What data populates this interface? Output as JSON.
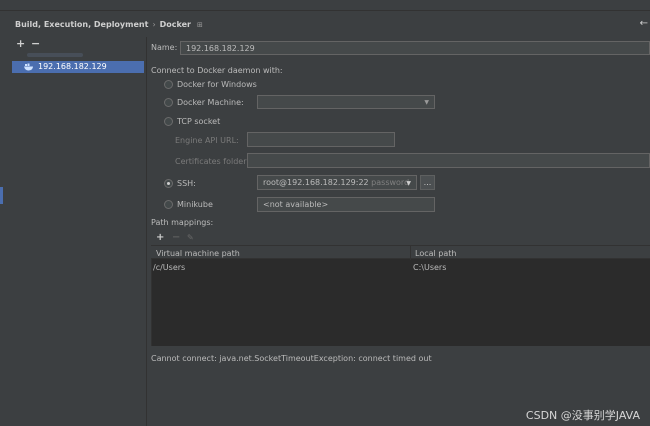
{
  "header": {
    "crumb_parent": "Build, Execution, Deployment",
    "crumb_sep": "›",
    "crumb_current": "Docker",
    "pin_icon": "⊞",
    "back_icon": "←"
  },
  "left": {
    "add_label": "+",
    "remove_label": "−",
    "selected_item": "192.168.182.129"
  },
  "form": {
    "name_label": "Name:",
    "name_value": "192.168.182.129",
    "connect_label": "Connect to Docker daemon with:",
    "options": {
      "windows": "Docker for Windows",
      "machine": "Docker Machine:",
      "tcp": "TCP socket",
      "engine_api": "Engine API URL:",
      "cert_folder": "Certificates folder:",
      "ssh": "SSH:",
      "ssh_value": "root@192.168.182.129:22",
      "ssh_hint": "password",
      "browse": "...",
      "minikube": "Minikube",
      "minikube_value": "<not available>"
    }
  },
  "path_mappings": {
    "label": "Path mappings:",
    "add": "+",
    "remove": "−",
    "edit": "✎",
    "columns": [
      "Virtual machine path",
      "Local path"
    ],
    "rows": [
      {
        "vm": "/c/Users",
        "local": "C:\\Users"
      }
    ]
  },
  "status": "Cannot connect: java.net.SocketTimeoutException: connect timed out",
  "watermark": "CSDN @没事别学JAVA",
  "colors": {
    "background": "#3c3f41",
    "selection": "#4b6eaf",
    "table": "#2b2b2b"
  }
}
